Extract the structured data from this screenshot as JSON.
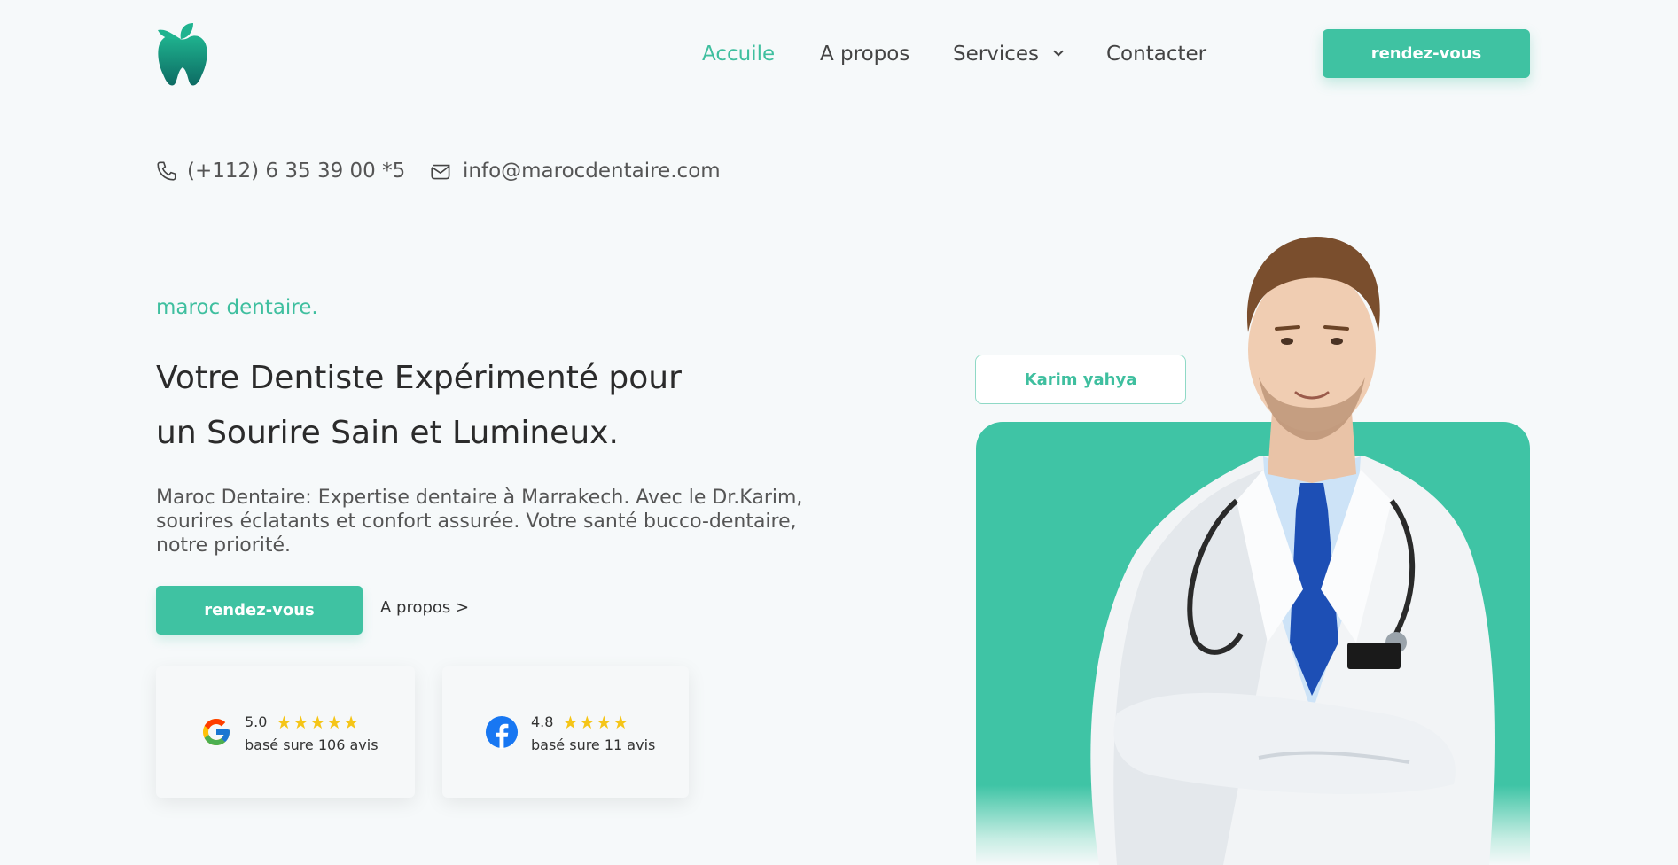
{
  "header": {
    "logo_icon": "tooth-leaf-icon",
    "nav": [
      {
        "label": "Accuile",
        "active": true
      },
      {
        "label": "A propos",
        "active": false
      },
      {
        "label": "Services",
        "active": false,
        "has_dropdown": true
      },
      {
        "label": "Contacter",
        "active": false
      }
    ],
    "cta_label": "rendez-vous"
  },
  "contact": {
    "phone": "(+112) 6 35 39 00 *5",
    "phone_icon": "phone-icon",
    "email": "info@marocdentaire.com",
    "email_icon": "mail-icon"
  },
  "hero": {
    "tagline": "maroc dentaire.",
    "headline_line1": "Votre Dentiste Expérimenté pour",
    "headline_line2": "un Sourire Sain et Lumineux.",
    "description": "Maroc Dentaire: Expertise dentaire à Marrakech. Avec le Dr.Karim, sourires éclatants et confort assurée. Votre santé bucco-dentaire, notre priorité.",
    "cta_label": "rendez-vous",
    "link_label": "A propos >"
  },
  "reviews": [
    {
      "source_icon": "google-icon",
      "rating": "5.0",
      "stars": "★★★★★",
      "caption": "basé sure 106 avis"
    },
    {
      "source_icon": "facebook-icon",
      "rating": "4.8",
      "stars": "★★★★",
      "caption": "basé sure 11 avis"
    }
  ],
  "doctor": {
    "name": "Karim yahya"
  },
  "colors": {
    "accent": "#3fc2a2",
    "background": "#f6f9fa",
    "text": "#333333",
    "star": "#f5c518"
  }
}
